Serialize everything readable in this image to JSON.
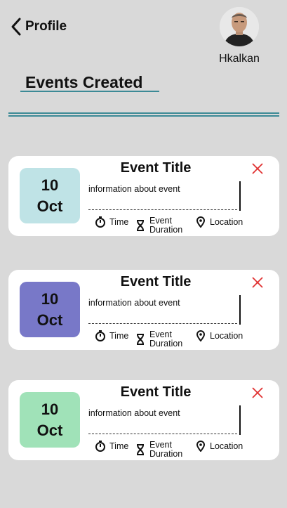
{
  "header": {
    "back_label": "Profile",
    "username": "Hkalkan"
  },
  "section": {
    "title": "Events Created"
  },
  "events": [
    {
      "day": "10",
      "month": "Oct",
      "title": "Event Title",
      "info": "information about event",
      "time_label": "Time",
      "duration_label": "Event Duration",
      "location_label": "Location",
      "color": "#bfe3e6"
    },
    {
      "day": "10",
      "month": "Oct",
      "title": "Event Title",
      "info": "information about event",
      "time_label": "Time",
      "duration_label": "Event Duration",
      "location_label": "Location",
      "color": "#7878c8"
    },
    {
      "day": "10",
      "month": "Oct",
      "title": "Event Title",
      "info": "information about event",
      "time_label": "Time",
      "duration_label": "Event Duration",
      "location_label": "Location",
      "color": "#a0e2b8"
    }
  ],
  "icons": {
    "back": "chevron-left-icon",
    "close": "close-icon",
    "time": "stopwatch-icon",
    "duration": "hourglass-icon",
    "location": "location-pin-icon"
  },
  "colors": {
    "background": "#d9d9d9",
    "accent": "#3c8a96",
    "close": "#e03030"
  }
}
